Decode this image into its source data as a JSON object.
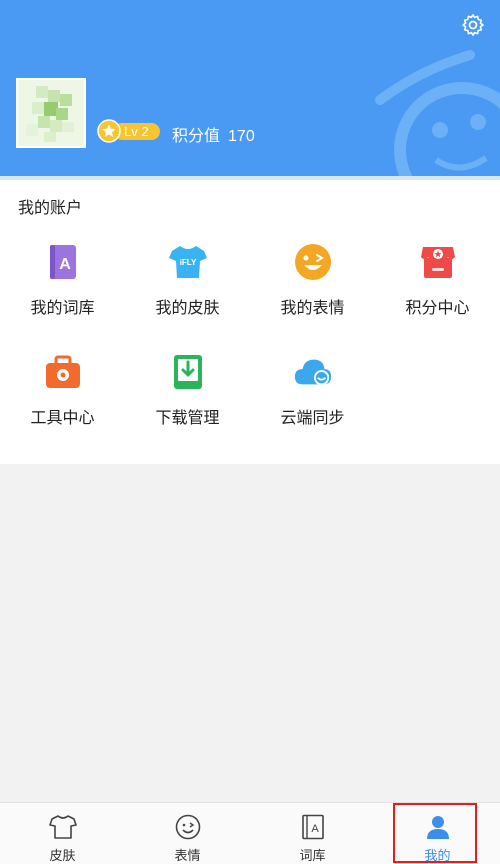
{
  "header": {
    "level_label": "Lv 2",
    "points_label": "积分值",
    "points_value": "170",
    "settings_icon": "gear-icon",
    "colors": {
      "background": "#4a9af3",
      "level_badge": "#f8c530"
    }
  },
  "account": {
    "title": "我的账户",
    "items": [
      {
        "label": "我的词库",
        "icon": "dictionary-icon"
      },
      {
        "label": "我的皮肤",
        "icon": "tshirt-icon"
      },
      {
        "label": "我的表情",
        "icon": "emoji-icon"
      },
      {
        "label": "积分中心",
        "icon": "shop-icon"
      },
      {
        "label": "工具中心",
        "icon": "toolbox-icon"
      },
      {
        "label": "下载管理",
        "icon": "download-icon"
      },
      {
        "label": "云端同步",
        "icon": "cloud-sync-icon"
      }
    ]
  },
  "tabbar": {
    "active": "我的",
    "tabs": [
      {
        "label": "皮肤",
        "icon": "tshirt-outline-icon"
      },
      {
        "label": "表情",
        "icon": "smile-outline-icon"
      },
      {
        "label": "词库",
        "icon": "book-outline-icon"
      },
      {
        "label": "我的",
        "icon": "person-icon"
      }
    ],
    "active_color": "#3d8ee8"
  }
}
